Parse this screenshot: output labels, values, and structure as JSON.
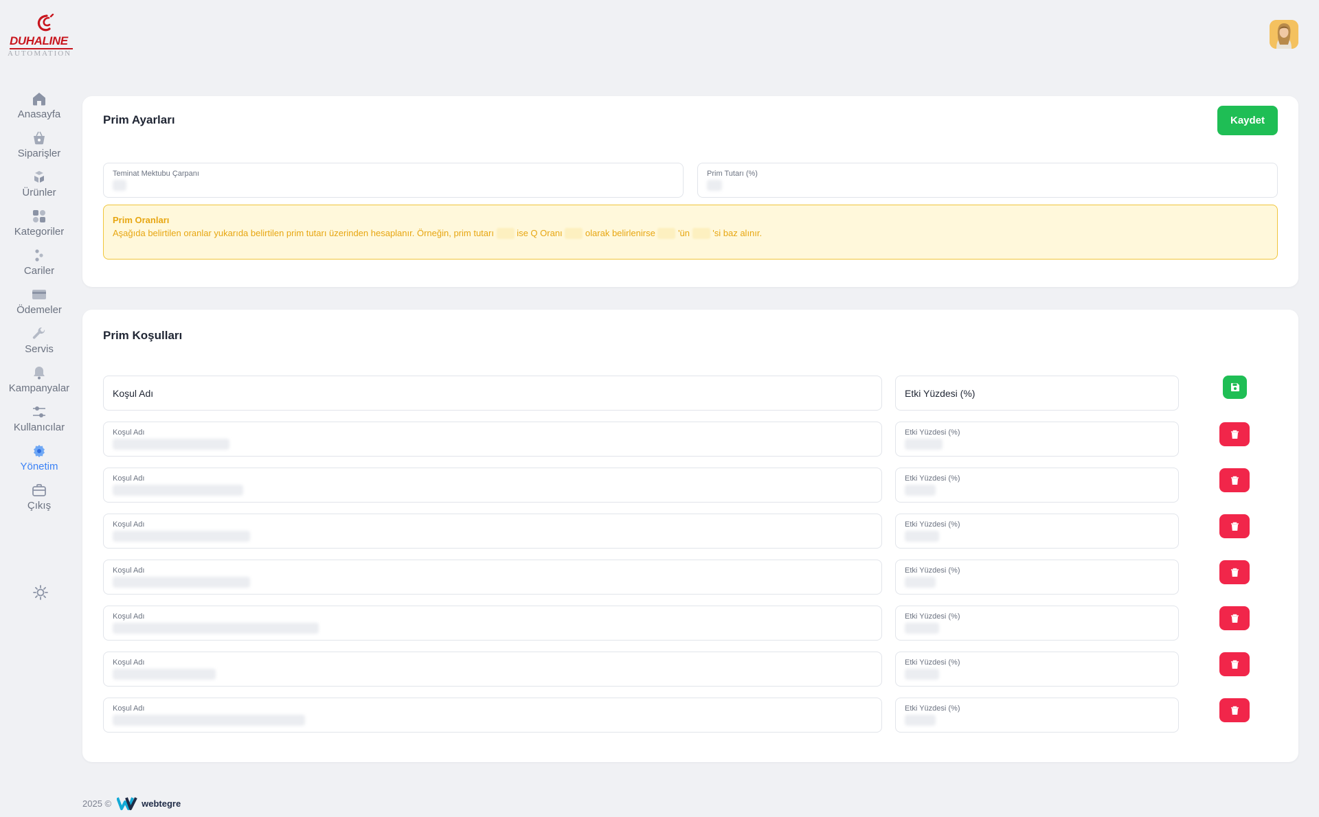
{
  "brand": {
    "name": "DUHALINE",
    "tagline": "AUTOMATION",
    "color": "#c8161e"
  },
  "user": {
    "avatar_icon": "user-avatar"
  },
  "sidebar": {
    "items": [
      {
        "label": "Anasayfa",
        "icon": "home-icon"
      },
      {
        "label": "Siparişler",
        "icon": "basket-icon"
      },
      {
        "label": "Ürünler",
        "icon": "boxes-icon"
      },
      {
        "label": "Kategoriler",
        "icon": "category-icon"
      },
      {
        "label": "Cariler",
        "icon": "users-icon"
      },
      {
        "label": "Ödemeler",
        "icon": "credit-card-icon"
      },
      {
        "label": "Servis",
        "icon": "wrench-icon"
      },
      {
        "label": "Kampanyalar",
        "icon": "bell-icon"
      },
      {
        "label": "Kullanıcılar",
        "icon": "sliders-icon"
      },
      {
        "label": "Yönetim",
        "icon": "gear-icon",
        "active": true
      },
      {
        "label": "Çıkış",
        "icon": "briefcase-icon"
      }
    ],
    "theme_toggle_icon": "sun-icon"
  },
  "settings": {
    "title": "Prim Ayarları",
    "save_label": "Kaydet",
    "fields": {
      "multiplier_label": "Teminat Mektubu Çarpanı",
      "amount_label": "Prim Tutarı (%)"
    },
    "alert": {
      "title": "Prim Oranları",
      "text_1": "Aşağıda belirtilen oranlar yukarıda belirtilen prim tutarı üzerinden hesaplanır. Örneğin, prim tutarı",
      "text_2": "ise Q Oranı",
      "text_3": "olarak belirlenirse",
      "text_4": "'ün",
      "text_5": "'si baz alınır."
    }
  },
  "conditions": {
    "title": "Prim Koşulları",
    "new_row": {
      "name_placeholder": "Koşul Adı",
      "percent_placeholder": "Etki Yüzdesi (%)"
    },
    "name_label": "Koşul Adı",
    "percent_label": "Etki Yüzdesi (%)",
    "rows_count_hint": 7
  },
  "footer": {
    "copyright": "2025 ©",
    "brand": "webtegre"
  },
  "colors": {
    "accent_green": "#1fbe55",
    "danger_red": "#f1264a",
    "active_blue": "#3b82f6",
    "warning_text": "#e7a611"
  }
}
